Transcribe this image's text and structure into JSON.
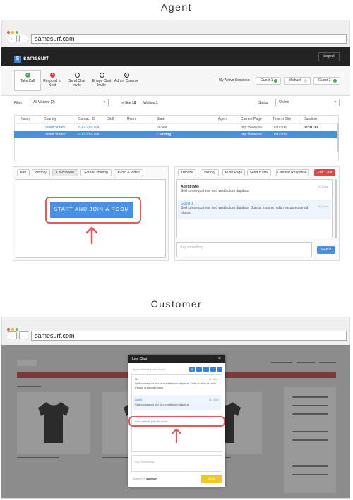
{
  "agent_section": {
    "heading": "Agent",
    "browser": {
      "url": "samesurf.com",
      "back": "←",
      "forward": "→"
    },
    "app": {
      "logo": "samesurf",
      "logout": "Logout",
      "tools": [
        {
          "label": "Take Call",
          "icon": "check-icon",
          "color": "#4caf50"
        },
        {
          "label": "Respond to Next",
          "icon": "x-icon",
          "color": "#e53935"
        },
        {
          "label": "Send Chat Invite",
          "icon": "circle-icon",
          "color": "#ffffff"
        },
        {
          "label": "Enage Chat Invite",
          "icon": "circle-icon",
          "color": "#ffffff"
        },
        {
          "label": "Admin Console",
          "icon": "dot-circle-icon",
          "color": "#ffffff"
        }
      ],
      "sessions_label": "My Active Sessions:",
      "sessions": [
        {
          "label": "Guest 1",
          "color": "#4caf50"
        },
        {
          "label": "Michael",
          "color": "#dddddd"
        },
        {
          "label": "Guest 2",
          "color": "#4caf50"
        }
      ],
      "filter_label": "Filter:",
      "filter_value": "All Visitors (2)",
      "insite_label": "In-Site",
      "insite_value": "10",
      "waiting_label": "Waiting",
      "waiting_value": "1",
      "status_label": "Status",
      "status_value": "Online",
      "table": {
        "headers": [
          "History",
          "Country",
          "Contact ID",
          "Skill",
          "Room",
          "State",
          "Agent",
          "Current Page",
          "Time in Site",
          "Duration"
        ],
        "rows": [
          {
            "country": "United States",
            "contact": "c-11-230-114...",
            "state": "In-Site",
            "page": "http://www.sa...",
            "time": "00:00:00",
            "duration": "00:01:30"
          },
          {
            "country": "United States",
            "contact": "c-11-230-114...",
            "state": "Chatting",
            "page": "http://www.sa...",
            "time": "00:00:00",
            "duration": ""
          }
        ]
      },
      "left_tabs": [
        "Info",
        "History",
        "Co-Browse",
        "Screen sharing",
        "Audio & Video"
      ],
      "join_button": "START AND JOIN A ROOM",
      "right_tabs": [
        "Transfer",
        "History",
        "Push Page",
        "Send HTML",
        "Canned Response"
      ],
      "end_chat": "End Chat",
      "messages": [
        {
          "name": "Agent (Me)",
          "time": "11:12pm",
          "text": "Sed consequat nisi nec vestibulum dapibus."
        },
        {
          "name": "Guest 1",
          "time": "11:12pm",
          "text": "Sed consequat nisi nec vestibulum dapibus. Duis at risus et nulla rhncus euismod phase"
        }
      ],
      "input_placeholder": "Say something...",
      "send": "SEND"
    }
  },
  "customer_section": {
    "heading": "Customer",
    "browser": {
      "url": "samesurf.com",
      "back": "←",
      "forward": "→"
    },
    "chat": {
      "title": "Live Chat",
      "close": "×",
      "subtitle": "Agent Helming with Guest",
      "messages": [
        {
          "name": "Me",
          "time": "11:12pm",
          "text": "Sed consequat nisi nec vestibulum dapibus. Duis at risus et nulla rhncus euismod phase."
        },
        {
          "name": "Agent",
          "time": "11:12pm",
          "text": "Sed consequat nisi nec vestibulum dapibus."
        }
      ],
      "join_link": "Click here to join the room",
      "input_placeholder": "Say Something...",
      "powered_by": "powered by",
      "brand": "samesurf",
      "send": "SEND"
    }
  },
  "colors": {
    "accent": "#4a90e2",
    "highlight": "#e05a5f",
    "selected_row": "#4a90e2",
    "send_yellow": "#f5c518"
  }
}
